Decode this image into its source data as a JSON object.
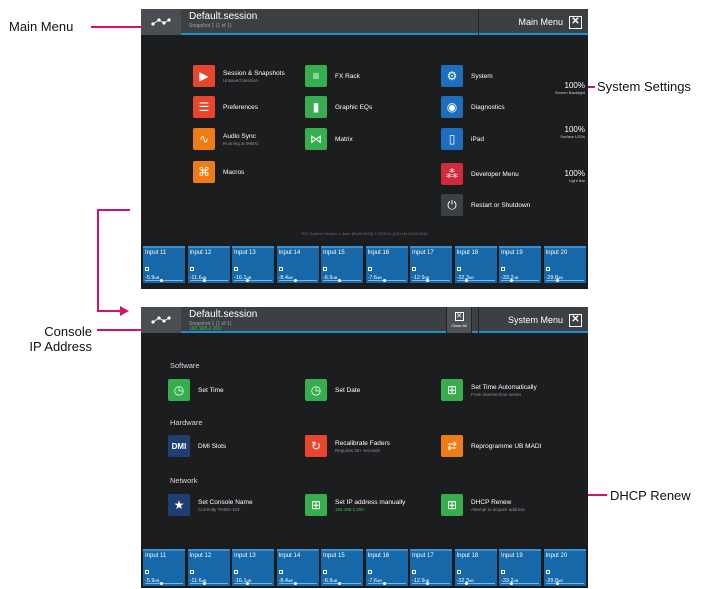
{
  "callouts": {
    "main_menu": "Main Menu",
    "system_settings": "System Settings",
    "console_ip_1": "Console",
    "console_ip_2": "IP Address",
    "dhcp_renew": "DHCP Renew"
  },
  "screen1": {
    "session": "Default.session",
    "snapshot": "Snapshot 1 (1 of 1)",
    "menu_title": "Main Menu",
    "tiles": [
      {
        "label": "Session & Snapshots",
        "sub": "Unsaved Session",
        "icon": "session-icon",
        "color": "#e8452f"
      },
      {
        "label": "Preferences",
        "sub": "",
        "icon": "preferences-icon",
        "color": "#e8452f"
      },
      {
        "label": "Audio Sync",
        "sub": "Running at 96kHz",
        "icon": "audio-sync-icon",
        "color": "#f07c16"
      },
      {
        "label": "Macros",
        "sub": "",
        "icon": "macros-icon",
        "color": "#f07c16"
      },
      {
        "label": "FX Rack",
        "sub": "",
        "icon": "fx-rack-icon",
        "color": "#36ae4f"
      },
      {
        "label": "Graphic EQs",
        "sub": "",
        "icon": "graphic-eq-icon",
        "color": "#36ae4f"
      },
      {
        "label": "Matrix",
        "sub": "",
        "icon": "matrix-icon",
        "color": "#36ae4f"
      },
      {
        "label": "System",
        "sub": "",
        "icon": "system-gears-icon",
        "color": "#1d6fbd"
      },
      {
        "label": "Diagnostics",
        "sub": "",
        "icon": "diagnostics-icon",
        "color": "#1d6fbd"
      },
      {
        "label": "iPad",
        "sub": "",
        "icon": "ipad-icon",
        "color": "#1d6fbd"
      },
      {
        "label": "Developer Menu",
        "sub": "",
        "icon": "developer-icon",
        "color": "#d12b3b"
      },
      {
        "label": "Restart or Shutdown",
        "sub": "",
        "icon": "power-icon",
        "color": "#3c3f43"
      }
    ],
    "levels": [
      {
        "value": "100%",
        "label": "Screen Backlight"
      },
      {
        "value": "100%",
        "label": "Surface LEDs"
      },
      {
        "value": "100%",
        "label": "Light Bar"
      }
    ],
    "version": "S21 System Version 1.4dev (Build 6928) © DiGiCo (UK) Ltd 2015-2016"
  },
  "screen2": {
    "session": "Default.session",
    "snapshot": "Snapshot 1 (1 of 1)",
    "ip_line": "192.168.2.200",
    "close_all": "Close All",
    "menu_title": "System Menu",
    "sections": {
      "software": "Software",
      "hardware": "Hardware",
      "network": "Network"
    },
    "tiles": [
      {
        "label": "Set Time",
        "sub": "",
        "icon": "clock-icon",
        "color": "#36ae4f"
      },
      {
        "label": "Set Date",
        "sub": "",
        "icon": "clock-icon",
        "color": "#36ae4f"
      },
      {
        "label": "Set Time Automatically",
        "sub": "From internet time server",
        "icon": "network-icon",
        "color": "#36ae4f"
      },
      {
        "label": "DMI Slots",
        "sub": "",
        "icon": "dmi-icon",
        "color": "#1f3f73"
      },
      {
        "label": "Recalibrate Faders",
        "sub": "Requires 30+ seconds",
        "icon": "recalibrate-icon",
        "color": "#e8452f"
      },
      {
        "label": "Reprogramme UB MADI",
        "sub": "",
        "icon": "usb-icon",
        "color": "#f07c16"
      },
      {
        "label": "Set Console Name",
        "sub": "Currently 'PABO-124'",
        "icon": "star-icon",
        "color": "#1f3f73"
      },
      {
        "label": "Set IP address manually",
        "sub": "192.168.2.200",
        "icon": "network-icon",
        "color": "#36ae4f"
      },
      {
        "label": "DHCP Renew",
        "sub": "Attempt to acquire address",
        "icon": "network-icon",
        "color": "#36ae4f"
      }
    ]
  },
  "channels": [
    {
      "name": "Input 11",
      "gain": "-5.9",
      "unit": "dB",
      "fader": 0.45
    },
    {
      "name": "Input 12",
      "gain": "-11.6",
      "unit": "dB",
      "fader": 0.4
    },
    {
      "name": "Input 13",
      "gain": "-16.1",
      "unit": "dB",
      "fader": 0.35
    },
    {
      "name": "Input 14",
      "gain": "-8.4",
      "unit": "dB",
      "fader": 0.45
    },
    {
      "name": "Input 15",
      "gain": "-6.9",
      "unit": "dB",
      "fader": 0.45
    },
    {
      "name": "Input 16",
      "gain": "-7.6",
      "unit": "dB",
      "fader": 0.45
    },
    {
      "name": "Input 17",
      "gain": "-12.9",
      "unit": "dB",
      "fader": 0.4
    },
    {
      "name": "Input 18",
      "gain": "-32.3",
      "unit": "dB",
      "fader": 0.25
    },
    {
      "name": "Input 19",
      "gain": "-33.2",
      "unit": "dB",
      "fader": 0.25
    },
    {
      "name": "Input 20",
      "gain": "-29.8",
      "unit": "dB",
      "fader": 0.3
    }
  ]
}
